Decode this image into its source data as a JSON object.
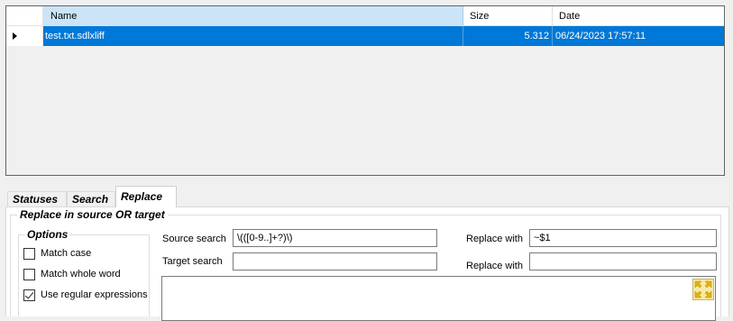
{
  "grid": {
    "columns": {
      "name": "Name",
      "size": "Size",
      "date": "Date"
    },
    "rows": [
      {
        "name": "test.txt.sdlxliff",
        "size": "5.312",
        "date": "06/24/2023 17:57:11"
      }
    ]
  },
  "tabs": [
    "Statuses",
    "Search",
    "Replace"
  ],
  "replace_group": {
    "title": "Replace in source OR target",
    "options": {
      "title": "Options",
      "match_case": "Match case",
      "match_whole_word": "Match whole word",
      "use_regex": "Use regular expressions",
      "match_case_checked": false,
      "match_whole_word_checked": false,
      "use_regex_checked": true
    },
    "source_search_label": "Source search",
    "source_search_value": "\\(([0-9..]+?)\\)",
    "target_search_label": "Target search",
    "target_search_value": "",
    "replace_with_label": "Replace with",
    "replace_with_value": "~$1",
    "replace_with_target_label": "Replace with",
    "replace_with_target_value": ""
  },
  "colors": {
    "selection": "#0078d7",
    "header_selected": "#cce4f7"
  },
  "icons": {
    "expand": "expand-arrows-icon",
    "row_indicator": "row-pointer-icon"
  }
}
